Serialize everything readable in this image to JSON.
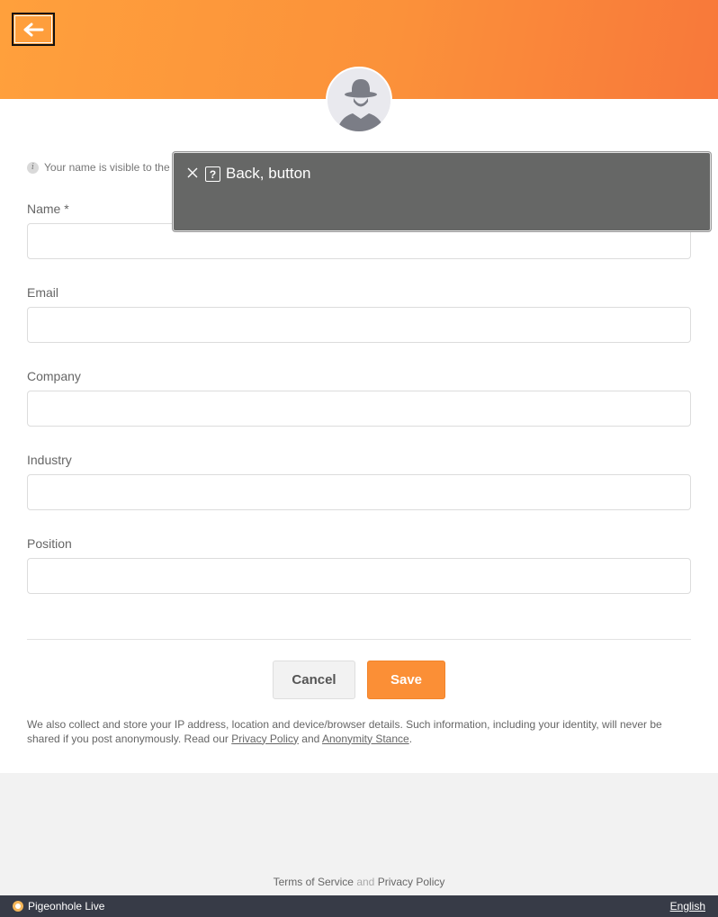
{
  "header": {
    "back_icon": "arrow-left-icon",
    "accent": "#fb913a"
  },
  "profile": {
    "avatar_icon": "anonymous-user-icon"
  },
  "note": {
    "icon": "info-icon",
    "icon_text": "i",
    "text": "Your name is visible to the"
  },
  "form": {
    "fields": [
      {
        "label": "Name *",
        "value": "",
        "placeholder": ""
      },
      {
        "label": "Email",
        "value": "",
        "placeholder": ""
      },
      {
        "label": "Company",
        "value": "",
        "placeholder": ""
      },
      {
        "label": "Industry",
        "value": "",
        "placeholder": ""
      },
      {
        "label": "Position",
        "value": "",
        "placeholder": ""
      }
    ],
    "cancel_label": "Cancel",
    "save_label": "Save",
    "save_color": "#fb8f36"
  },
  "disclaimer": {
    "text_before": "We also collect and store your IP address, location and device/browser details. Such information, including your identity, will never be shared if you post anonymously. Read our ",
    "privacy_link": "Privacy Policy",
    "text_and": " and ",
    "anonymity_link": "Anonymity Stance",
    "text_end": "."
  },
  "footer": {
    "terms": "Terms of Service",
    "and": " and ",
    "privacy": "Privacy Policy",
    "brand": "Pigeonhole Live",
    "language": "English"
  },
  "tooltip": {
    "close_icon": "close-icon",
    "help_icon": "question-icon",
    "help_glyph": "?",
    "text": "Back, button"
  }
}
